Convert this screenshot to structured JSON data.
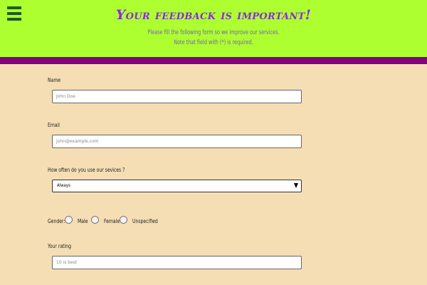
{
  "header": {
    "title": "Your feedback is important!",
    "subtitle_line1": "Please fill the following form so we improve our services.",
    "subtitle_line2": "Note that field with (*) is required."
  },
  "form": {
    "name": {
      "label": "Name",
      "placeholder": "John Doe"
    },
    "email": {
      "label": "Email",
      "placeholder": "john@example.com"
    },
    "frequency": {
      "label": "How often do you use our sevices ?",
      "selected": "Always"
    },
    "gender": {
      "label": "Gender:",
      "options": [
        "Male",
        "Female",
        "Unspecified"
      ]
    },
    "rating": {
      "label": "Your rating",
      "placeholder": "10 is best"
    }
  },
  "colors": {
    "header_bg": "#adff2f",
    "accent_bar": "#800080",
    "page_bg": "#f5deb3",
    "title": "#8a2be2"
  }
}
